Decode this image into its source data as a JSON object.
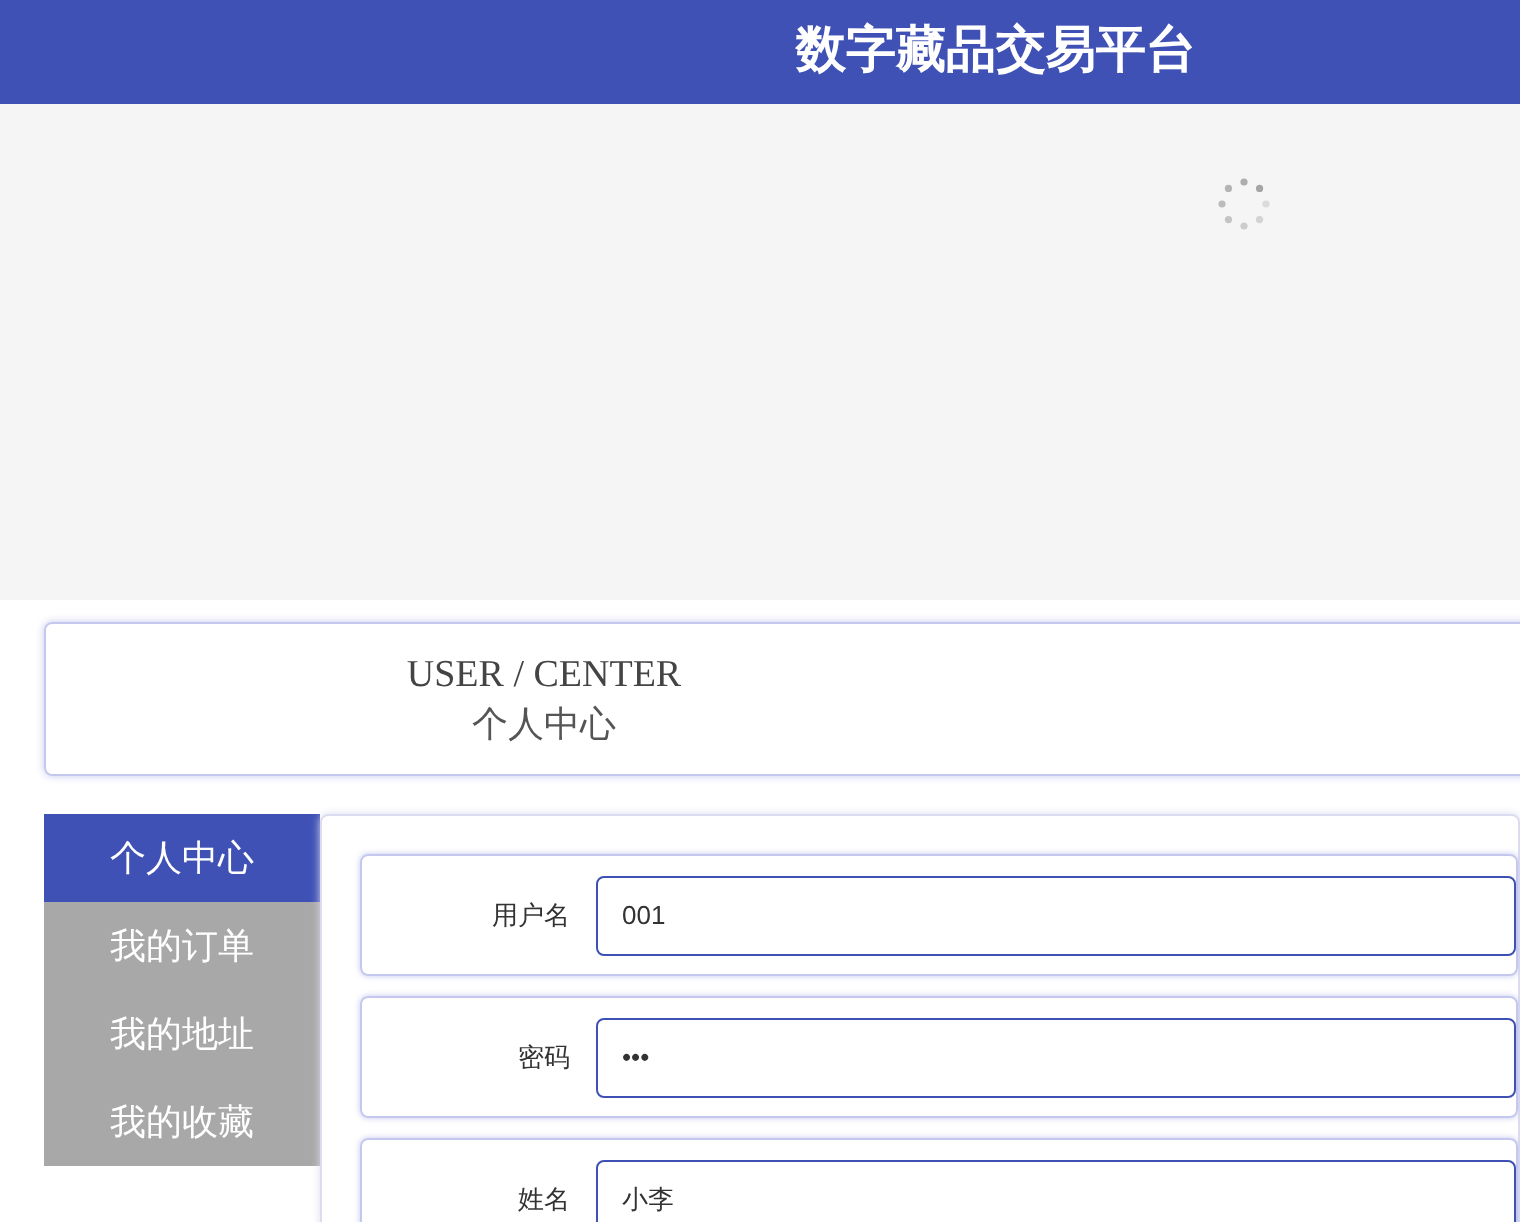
{
  "header": {
    "title": "数字藏品交易平台"
  },
  "banner": {
    "loading": true
  },
  "page_heading": {
    "english": "USER / CENTER",
    "chinese": "个人中心"
  },
  "sidebar": {
    "items": [
      {
        "label": "个人中心",
        "selected": true
      },
      {
        "label": "我的订单",
        "selected": false
      },
      {
        "label": "我的地址",
        "selected": false
      },
      {
        "label": "我的收藏",
        "selected": false
      }
    ]
  },
  "form": {
    "fields": [
      {
        "label": "用户名",
        "value": "001"
      },
      {
        "label": "密码",
        "value": "•••"
      },
      {
        "label": "姓名",
        "value": "小李"
      }
    ]
  }
}
